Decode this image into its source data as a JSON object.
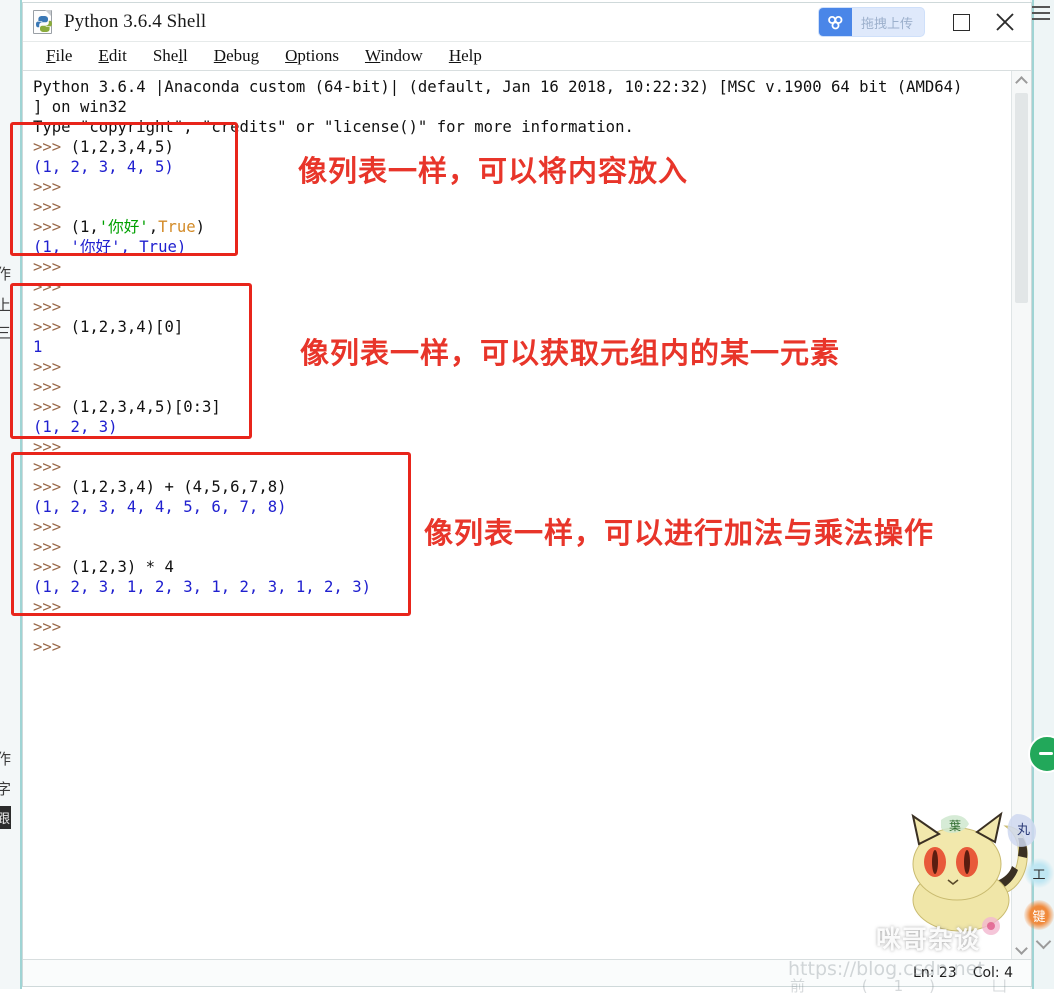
{
  "window": {
    "title": "Python 3.6.4 Shell",
    "app_icon": "python-file-icon",
    "upload_button": {
      "label": "拖拽上传",
      "icon": "cloud-upload-icon",
      "accent": "#4a86e8"
    },
    "maximize_label": "□",
    "close_label": "✕"
  },
  "menubar": {
    "items": [
      {
        "label": "File",
        "mnemonic": "F"
      },
      {
        "label": "Edit",
        "mnemonic": "E"
      },
      {
        "label": "Shell",
        "mnemonic": "l"
      },
      {
        "label": "Debug",
        "mnemonic": "D"
      },
      {
        "label": "Options",
        "mnemonic": "O"
      },
      {
        "label": "Window",
        "mnemonic": "W"
      },
      {
        "label": "Help",
        "mnemonic": "H"
      }
    ]
  },
  "shell": {
    "banner_line_1": "Python 3.6.4 |Anaconda custom (64-bit)| (default, Jan 16 2018, 10:22:32) [MSC v.1900 64 bit (AMD64)",
    "banner_line_2": "] on win32",
    "banner_line_3": "Type \"copyright\", \"credits\" or \"license()\" for more information.",
    "prompt": ">>>",
    "entries": [
      {
        "kind": "input",
        "text": "(1,2,3,4,5)"
      },
      {
        "kind": "output",
        "text": "(1, 2, 3, 4, 5)"
      },
      {
        "kind": "blank_prompt"
      },
      {
        "kind": "blank_prompt"
      },
      {
        "kind": "input_mixed",
        "pre": "(1,",
        "str": "'你好'",
        "mid": ",",
        "kw": "True",
        "post": ")"
      },
      {
        "kind": "output",
        "text": "(1, '你好', True)"
      },
      {
        "kind": "blank_prompt"
      },
      {
        "kind": "blank_prompt"
      },
      {
        "kind": "blank_prompt"
      },
      {
        "kind": "input",
        "text": "(1,2,3,4)[0]"
      },
      {
        "kind": "output",
        "text": "1"
      },
      {
        "kind": "blank_prompt"
      },
      {
        "kind": "blank_prompt"
      },
      {
        "kind": "input",
        "text": "(1,2,3,4,5)[0:3]"
      },
      {
        "kind": "output",
        "text": "(1, 2, 3)"
      },
      {
        "kind": "blank_prompt"
      },
      {
        "kind": "blank_prompt"
      },
      {
        "kind": "input",
        "text": "(1,2,3,4) + (4,5,6,7,8)"
      },
      {
        "kind": "output",
        "text": "(1, 2, 3, 4, 4, 5, 6, 7, 8)"
      },
      {
        "kind": "blank_prompt"
      },
      {
        "kind": "blank_prompt"
      },
      {
        "kind": "input",
        "text": "(1,2,3) * 4"
      },
      {
        "kind": "output",
        "text": "(1, 2, 3, 1, 2, 3, 1, 2, 3, 1, 2, 3)"
      },
      {
        "kind": "blank_prompt"
      },
      {
        "kind": "blank_prompt"
      },
      {
        "kind": "blank_prompt"
      }
    ],
    "colors": {
      "prompt": "#9a6a4a",
      "output": "#2020cf",
      "string": "#00a000",
      "keyword": "#d38b28",
      "normal": "#111111"
    }
  },
  "annotations": {
    "color": "#e8352a",
    "items": [
      {
        "text": "像列表一样，可以将内容放入",
        "name": "annotation-put-content"
      },
      {
        "text": "像列表一样，可以获取元组内的某一元素",
        "name": "annotation-index-element"
      },
      {
        "text": "像列表一样，可以进行加法与乘法操作",
        "name": "annotation-add-multiply"
      }
    ],
    "boxes": 3
  },
  "statusbar": {
    "line_label": "Ln: 23",
    "col_label": "Col: 4"
  },
  "overlay": {
    "brand_watermark": "咪哥杂谈",
    "url_watermark": "https://blog.csdn.net",
    "mascot": "cat-mascot",
    "faint_icons": "前  (1)  凵  ()"
  },
  "background": {
    "left_fragments": [
      "作",
      "上",
      "三",
      "作",
      "字",
      "跟"
    ],
    "right_icons": [
      "green-circle-icon",
      "blue-badge-icon",
      "orange-badge-icon"
    ]
  }
}
